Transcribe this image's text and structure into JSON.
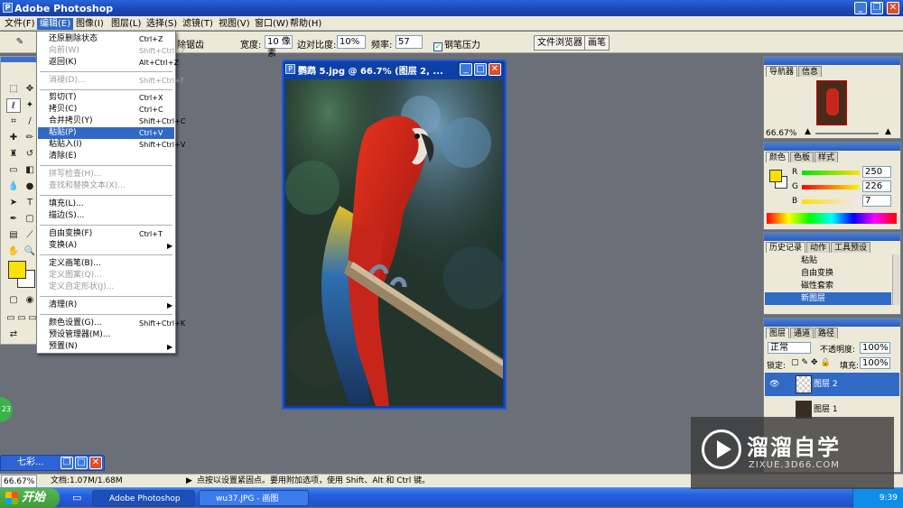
{
  "app": {
    "title": "Adobe Photoshop"
  },
  "menubar": {
    "items": [
      "文件(F)",
      "编辑(E)",
      "图像(I)",
      "图层(L)",
      "选择(S)",
      "滤镜(T)",
      "视图(V)",
      "窗口(W)",
      "帮助(H)"
    ]
  },
  "options": {
    "anti_alias": "除锯齿",
    "width_label": "宽度:",
    "width_value": "10 像素",
    "contrast_label": "边对比度:",
    "contrast_value": "10%",
    "freq_label": "频率:",
    "freq_value": "57",
    "pen_pressure": "钢笔压力",
    "tab_file_browser": "文件浏览器",
    "tab_brushes": "画笔"
  },
  "edit_menu": [
    {
      "label": "还原删除状态",
      "shortcut": "Ctrl+Z",
      "disabled": false
    },
    {
      "label": "向前(W)",
      "shortcut": "Shift+Ctrl+Z",
      "disabled": true
    },
    {
      "label": "返回(K)",
      "shortcut": "Alt+Ctrl+Z",
      "disabled": false
    },
    {
      "label": "消褪(D)...",
      "shortcut": "Shift+Ctrl+F",
      "disabled": true
    },
    {
      "label": "剪切(T)",
      "shortcut": "Ctrl+X",
      "disabled": false
    },
    {
      "label": "拷贝(C)",
      "shortcut": "Ctrl+C",
      "disabled": false
    },
    {
      "label": "合并拷贝(Y)",
      "shortcut": "Shift+Ctrl+C",
      "disabled": false
    },
    {
      "label": "粘贴(P)",
      "shortcut": "Ctrl+V",
      "disabled": false,
      "selected": true
    },
    {
      "label": "粘贴入(I)",
      "shortcut": "Shift+Ctrl+V",
      "disabled": false
    },
    {
      "label": "清除(E)",
      "shortcut": "",
      "disabled": false
    },
    {
      "label": "拼写检查(H)...",
      "shortcut": "",
      "disabled": true
    },
    {
      "label": "查找和替换文本(X)...",
      "shortcut": "",
      "disabled": true
    },
    {
      "label": "填充(L)...",
      "shortcut": "",
      "disabled": false
    },
    {
      "label": "描边(S)...",
      "shortcut": "",
      "disabled": false
    },
    {
      "label": "自由变换(F)",
      "shortcut": "Ctrl+T",
      "disabled": false
    },
    {
      "label": "变换(A)",
      "shortcut": "",
      "disabled": false,
      "submenu": true
    },
    {
      "label": "定义画笔(B)...",
      "shortcut": "",
      "disabled": false
    },
    {
      "label": "定义图案(Q)...",
      "shortcut": "",
      "disabled": true
    },
    {
      "label": "定义自定形状(J)...",
      "shortcut": "",
      "disabled": true
    },
    {
      "label": "清理(R)",
      "shortcut": "",
      "disabled": false,
      "submenu": true
    },
    {
      "label": "颜色设置(G)...",
      "shortcut": "Shift+Ctrl+K",
      "disabled": false
    },
    {
      "label": "预设管理器(M)...",
      "shortcut": "",
      "disabled": false
    },
    {
      "label": "预置(N)",
      "shortcut": "",
      "disabled": false,
      "submenu": true
    }
  ],
  "document": {
    "title": "鹦鹉 5.jpg @ 66.7% (图层 2, ..."
  },
  "navigator": {
    "tab1": "导航器",
    "tab2": "信息",
    "zoom": "66.67%"
  },
  "color": {
    "tab1": "颜色",
    "tab2": "色板",
    "tab3": "样式",
    "r_label": "R",
    "g_label": "G",
    "b_label": "B",
    "r": "250",
    "g": "226",
    "b": "7",
    "foreground": "#fae207"
  },
  "history": {
    "tab1": "历史记录",
    "tab2": "动作",
    "tab3": "工具预设",
    "items": [
      "粘贴",
      "自由变换",
      "磁性套索",
      "新图层"
    ]
  },
  "layers": {
    "tab1": "图层",
    "tab2": "通道",
    "tab3": "路径",
    "blend": "正常",
    "opacity_label": "不透明度:",
    "opacity": "100%",
    "lock_label": "锁定:",
    "fill_label": "填充:",
    "fill": "100%",
    "items": [
      "图层 2",
      "图层 1"
    ]
  },
  "status": {
    "zoom": "66.67%",
    "doc": "文档:1.07M/1.68M",
    "hint": "点按以设置紧固点。要用附加选项，使用 Shift、Alt 和 Ctrl 键。"
  },
  "minimized": {
    "title": "七彩..."
  },
  "badge": {
    "value": "23"
  },
  "taskbar": {
    "start": "开始",
    "task1": "Adobe Photoshop",
    "task2": "wu37.JPG - 画图",
    "time": "9:39"
  },
  "watermark": {
    "brand": "溜溜自学",
    "url": "ZIXUE.3D66.COM"
  }
}
